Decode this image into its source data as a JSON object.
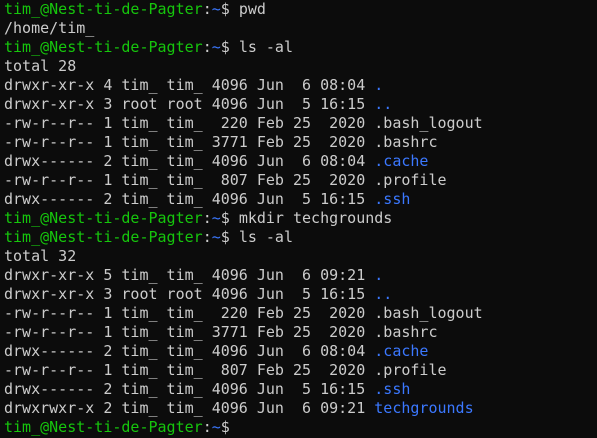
{
  "terminal": {
    "prompt": {
      "user_host": "tim_@Nest-ti-de-Pagter",
      "sep": ":",
      "path": "~",
      "dollar": "$ "
    },
    "colors": {
      "background": "#0c0c0c",
      "text": "#cccccc",
      "prompt_green": "#16c60c",
      "directory_blue": "#3b78ff"
    },
    "lines": [
      {
        "type": "prompt",
        "command": "pwd"
      },
      {
        "type": "output",
        "text": "/home/tim_"
      },
      {
        "type": "prompt",
        "command": "ls -al"
      },
      {
        "type": "output",
        "text": "total 28"
      },
      {
        "type": "listing",
        "meta": "drwxr-xr-x 4 tim_ tim_ 4096 Jun  6 08:04 ",
        "name": ".",
        "is_dir": true
      },
      {
        "type": "listing",
        "meta": "drwxr-xr-x 3 root root 4096 Jun  5 16:15 ",
        "name": "..",
        "is_dir": true
      },
      {
        "type": "listing",
        "meta": "-rw-r--r-- 1 tim_ tim_  220 Feb 25  2020 ",
        "name": ".bash_logout",
        "is_dir": false
      },
      {
        "type": "listing",
        "meta": "-rw-r--r-- 1 tim_ tim_ 3771 Feb 25  2020 ",
        "name": ".bashrc",
        "is_dir": false
      },
      {
        "type": "listing",
        "meta": "drwx------ 2 tim_ tim_ 4096 Jun  6 08:04 ",
        "name": ".cache",
        "is_dir": true
      },
      {
        "type": "listing",
        "meta": "-rw-r--r-- 1 tim_ tim_  807 Feb 25  2020 ",
        "name": ".profile",
        "is_dir": false
      },
      {
        "type": "listing",
        "meta": "drwx------ 2 tim_ tim_ 4096 Jun  5 16:15 ",
        "name": ".ssh",
        "is_dir": true
      },
      {
        "type": "prompt",
        "command": "mkdir techgrounds"
      },
      {
        "type": "prompt",
        "command": "ls -al"
      },
      {
        "type": "output",
        "text": "total 32"
      },
      {
        "type": "listing",
        "meta": "drwxr-xr-x 5 tim_ tim_ 4096 Jun  6 09:21 ",
        "name": ".",
        "is_dir": true
      },
      {
        "type": "listing",
        "meta": "drwxr-xr-x 3 root root 4096 Jun  5 16:15 ",
        "name": "..",
        "is_dir": true
      },
      {
        "type": "listing",
        "meta": "-rw-r--r-- 1 tim_ tim_  220 Feb 25  2020 ",
        "name": ".bash_logout",
        "is_dir": false
      },
      {
        "type": "listing",
        "meta": "-rw-r--r-- 1 tim_ tim_ 3771 Feb 25  2020 ",
        "name": ".bashrc",
        "is_dir": false
      },
      {
        "type": "listing",
        "meta": "drwx------ 2 tim_ tim_ 4096 Jun  6 08:04 ",
        "name": ".cache",
        "is_dir": true
      },
      {
        "type": "listing",
        "meta": "-rw-r--r-- 1 tim_ tim_  807 Feb 25  2020 ",
        "name": ".profile",
        "is_dir": false
      },
      {
        "type": "listing",
        "meta": "drwx------ 2 tim_ tim_ 4096 Jun  5 16:15 ",
        "name": ".ssh",
        "is_dir": true
      },
      {
        "type": "listing",
        "meta": "drwxrwxr-x 2 tim_ tim_ 4096 Jun  6 09:21 ",
        "name": "techgrounds",
        "is_dir": true
      },
      {
        "type": "prompt",
        "command": ""
      }
    ]
  }
}
